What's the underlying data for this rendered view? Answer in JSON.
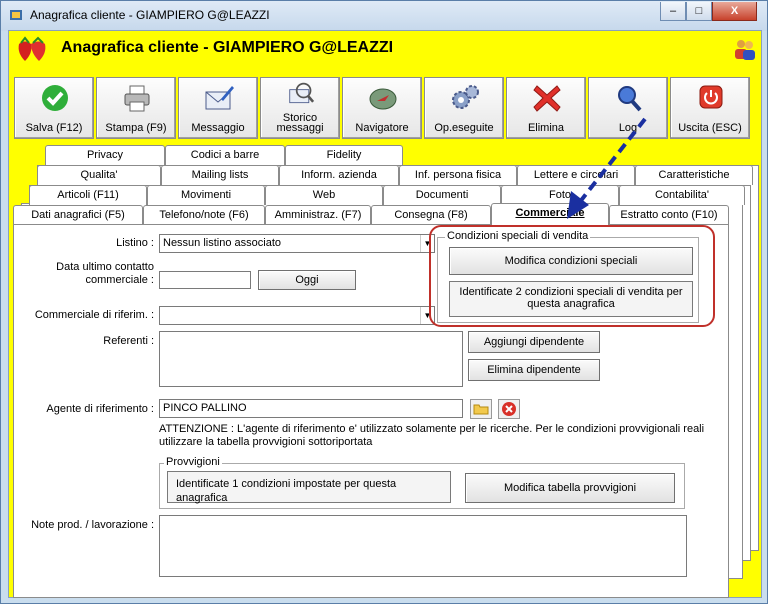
{
  "window": {
    "title": "Anagrafica cliente - GIAMPIERO G@LEAZZI",
    "controls": {
      "minimize": "–",
      "maximize": "□",
      "close": "X"
    }
  },
  "header": {
    "title": "Anagrafica cliente - GIAMPIERO G@LEAZZI"
  },
  "toolbar": {
    "save": "Salva (F12)",
    "print": "Stampa (F9)",
    "message": "Messaggio",
    "history_1": "Storico",
    "history_2": "messaggi",
    "navigator": "Navigatore",
    "ops": "Op.eseguite",
    "delete": "Elimina",
    "log": "Log",
    "exit": "Uscita (ESC)"
  },
  "tabs": {
    "row1": [
      "Privacy",
      "Codici a barre",
      "Fidelity"
    ],
    "row2": [
      "Qualita'",
      "Mailing lists",
      "Inform. azienda",
      "Inf. persona fisica",
      "Lettere e circolari",
      "Caratteristiche"
    ],
    "row3": [
      "Articoli (F11)",
      "Movimenti",
      "Web",
      "Documenti",
      "Foto",
      "Contabilita'"
    ],
    "row4": [
      "Dati anagrafici (F5)",
      "Telefono/note (F6)",
      "Amministraz. (F7)",
      "Consegna (F8)",
      "Commerciale",
      "Estratto conto (F10)"
    ]
  },
  "form": {
    "listino_label": "Listino :",
    "listino_value": "Nessun listino associato",
    "last_contact_label_1": "Data ultimo contatto",
    "last_contact_label_2": "commerciale :",
    "last_contact_value": "",
    "today_button": "Oggi",
    "commercial_label": "Commerciale di riferim. :",
    "commercial_value": "",
    "referenti_label": "Referenti :",
    "add_employee": "Aggiungi dipendente",
    "remove_employee": "Elimina dipendente",
    "agent_label": "Agente di riferimento :",
    "agent_value": "PINCO PALLINO",
    "warning_1": "ATTENZIONE : L'agente di riferimento e' utilizzato solamente per le ricerche. Per le condizioni provvigionali reali",
    "warning_2": "utilizzare la tabella provvigioni sottoriportata",
    "provvigioni_title": "Provvigioni",
    "provvigioni_info": "Identificate 1 condizioni impostate per questa anagrafica",
    "provvigioni_button": "Modifica tabella provvigioni",
    "notes_label": "Note prod. / lavorazione :"
  },
  "special": {
    "title": "Condizioni speciali di vendita",
    "button": "Modifica condizioni speciali",
    "info_1": "Identificate 2 condizioni speciali di vendita per",
    "info_2": "questa anagrafica"
  },
  "colors": {
    "background": "#ffff00",
    "highlight_outline": "#c0302a",
    "arrow": "#1a2fa0"
  }
}
